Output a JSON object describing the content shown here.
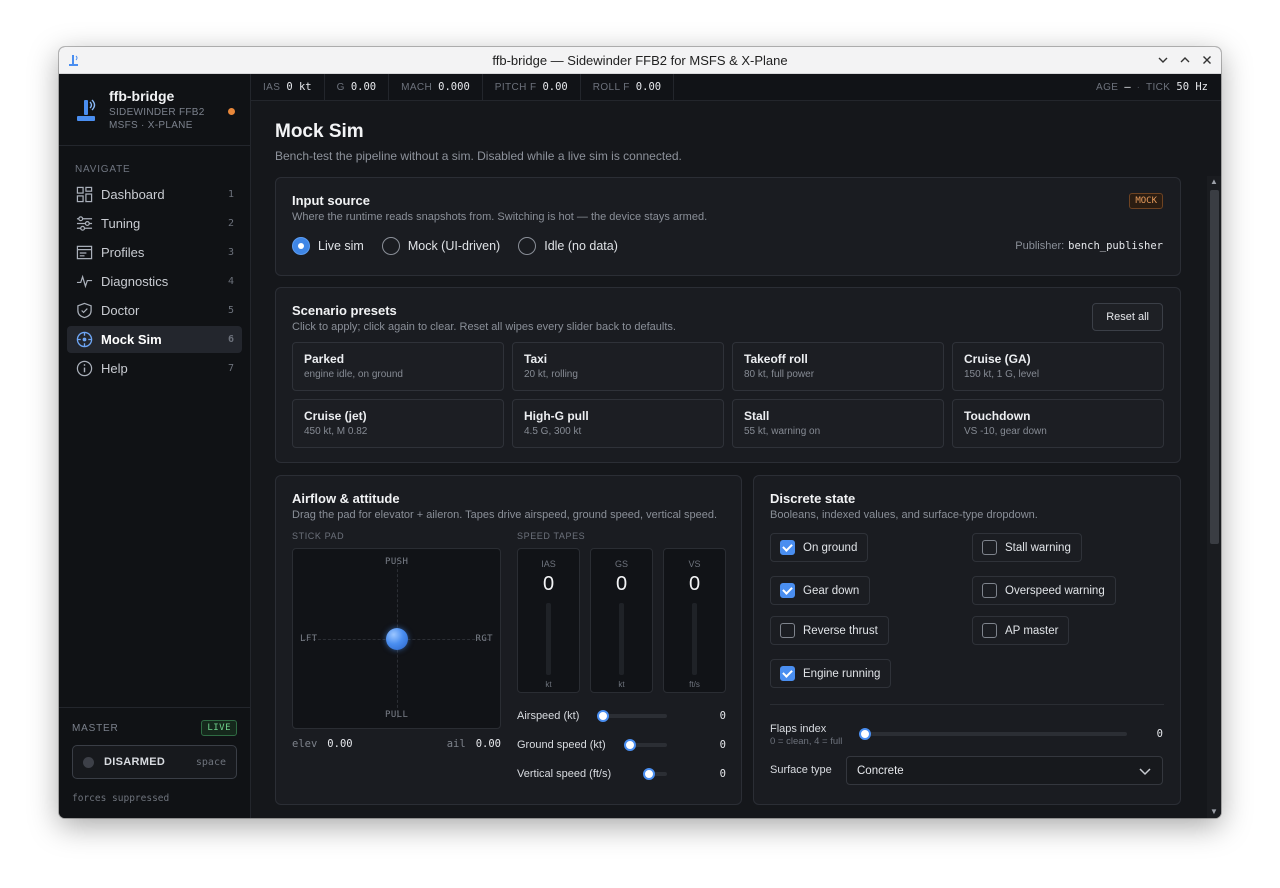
{
  "window": {
    "title": "ffb-bridge — Sidewinder FFB2 for MSFS & X-Plane"
  },
  "brand": {
    "name": "ffb-bridge",
    "sub1": "SIDEWINDER FFB2",
    "sub2": "MSFS · X-PLANE"
  },
  "nav": {
    "label": "NAVIGATE",
    "items": [
      {
        "label": "Dashboard",
        "num": "1",
        "icon": "dashboard-icon"
      },
      {
        "label": "Tuning",
        "num": "2",
        "icon": "sliders-icon"
      },
      {
        "label": "Profiles",
        "num": "3",
        "icon": "profile-card-icon"
      },
      {
        "label": "Diagnostics",
        "num": "4",
        "icon": "pulse-icon"
      },
      {
        "label": "Doctor",
        "num": "5",
        "icon": "shield-check-icon"
      },
      {
        "label": "Mock Sim",
        "num": "6",
        "icon": "crosshair-icon",
        "active": true
      },
      {
        "label": "Help",
        "num": "7",
        "icon": "info-icon"
      }
    ]
  },
  "master": {
    "label": "MASTER",
    "badge": "LIVE",
    "button": "DISARMED",
    "key": "space",
    "note": "forces suppressed"
  },
  "telemetry": {
    "ias": {
      "k": "IAS",
      "v": "0 kt"
    },
    "g": {
      "k": "G",
      "v": "0.00"
    },
    "mach": {
      "k": "MACH",
      "v": "0.000"
    },
    "pitchf": {
      "k": "PITCH F",
      "v": "0.00"
    },
    "rollf": {
      "k": "ROLL F",
      "v": "0.00"
    },
    "age": {
      "k": "AGE",
      "v": "—"
    },
    "sep": "·",
    "tick": {
      "k": "TICK",
      "v": "50 Hz"
    }
  },
  "page": {
    "title": "Mock Sim",
    "subtitle": "Bench-test the pipeline without a sim. Disabled while a live sim is connected."
  },
  "input_source": {
    "title": "Input source",
    "subtitle": "Where the runtime reads snapshots from. Switching is hot — the device stays armed.",
    "badge": "MOCK",
    "options": [
      "Live sim",
      "Mock (UI-driven)",
      "Idle (no data)"
    ],
    "selected": "Live sim",
    "publisher_label": "Publisher:",
    "publisher_value": "bench_publisher"
  },
  "presets": {
    "title": "Scenario presets",
    "subtitle": "Click to apply; click again to clear. Reset all wipes every slider back to defaults.",
    "reset_label": "Reset all",
    "items": [
      {
        "name": "Parked",
        "desc": "engine idle, on ground"
      },
      {
        "name": "Taxi",
        "desc": "20 kt, rolling"
      },
      {
        "name": "Takeoff roll",
        "desc": "80 kt, full power"
      },
      {
        "name": "Cruise (GA)",
        "desc": "150 kt, 1 G, level"
      },
      {
        "name": "Cruise (jet)",
        "desc": "450 kt, M 0.82"
      },
      {
        "name": "High-G pull",
        "desc": "4.5 G, 300 kt"
      },
      {
        "name": "Stall",
        "desc": "55 kt, warning on"
      },
      {
        "name": "Touchdown",
        "desc": "VS -10, gear down"
      }
    ]
  },
  "airflow": {
    "title": "Airflow & attitude",
    "subtitle": "Drag the pad for elevator + aileron. Tapes drive airspeed, ground speed, vertical speed.",
    "stick_label": "STICK PAD",
    "tapes_label": "SPEED TAPES",
    "pad": {
      "push": "PUSH",
      "pull": "PULL",
      "left": "LFT",
      "right": "RGT"
    },
    "elev": {
      "k": "elev",
      "v": "0.00"
    },
    "ail": {
      "k": "ail",
      "v": "0.00"
    },
    "tapes": [
      {
        "k": "IAS",
        "v": "0",
        "u": "kt"
      },
      {
        "k": "GS",
        "v": "0",
        "u": "kt"
      },
      {
        "k": "VS",
        "v": "0",
        "u": "ft/s"
      }
    ],
    "sliders": [
      {
        "label": "Airspeed (kt)",
        "value": "0"
      },
      {
        "label": "Ground speed (kt)",
        "value": "0"
      },
      {
        "label": "Vertical speed (ft/s)",
        "value": "0"
      }
    ]
  },
  "discrete": {
    "title": "Discrete state",
    "subtitle": "Booleans, indexed values, and surface-type dropdown.",
    "checks": [
      {
        "label": "On ground",
        "checked": true
      },
      {
        "label": "Stall warning",
        "checked": false
      },
      {
        "label": "Gear down",
        "checked": true
      },
      {
        "label": "Overspeed warning",
        "checked": false
      },
      {
        "label": "Reverse thrust",
        "checked": false
      },
      {
        "label": "AP master",
        "checked": false
      },
      {
        "label": "Engine running",
        "checked": true
      }
    ],
    "flaps_label": "Flaps index",
    "flaps_hint": "0 = clean, 4 = full",
    "flaps_value": "0",
    "surface_label": "Surface type",
    "surface_value": "Concrete"
  },
  "colors": {
    "accent": "#4a8ef0",
    "live": "#6fd28b",
    "mock": "#e59a5b",
    "status_dot": "#e8873a"
  }
}
